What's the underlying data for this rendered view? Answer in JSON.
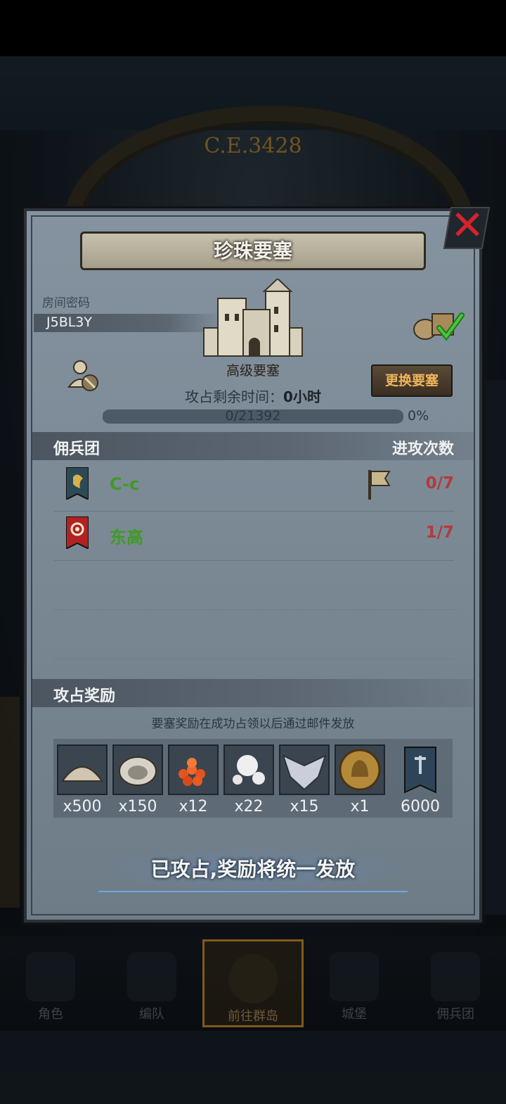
{
  "background": {
    "era_text": "C.E.3428"
  },
  "bottom_nav": [
    {
      "label": "角色"
    },
    {
      "label": "编队"
    },
    {
      "label": "前往群岛"
    },
    {
      "label": "城堡"
    },
    {
      "label": "佣兵团"
    }
  ],
  "dialog": {
    "title": "珍珠要塞",
    "room_label": "房间密码",
    "room_code": "J5BL3Y",
    "fortress_level": "高级要塞",
    "time_label": "攻占剩余时间：",
    "time_value": "0小时",
    "switch_button": "更换要塞",
    "progress_text": "0/21392",
    "progress_fraction": 0,
    "progress_percent": "0%",
    "mercenary_header": "佣兵团",
    "attack_header": "进攻次数",
    "mercenaries": [
      {
        "name": "C-c",
        "attacks": "0/7",
        "banner_color": "#2c4a55",
        "emblem_color": "#d7b24a"
      },
      {
        "name": "东高",
        "attacks": "1/7",
        "banner_color": "#b32222",
        "emblem_color": "#f2e8d0"
      }
    ],
    "reward_header": "攻占奖励",
    "reward_note": "要塞奖励在成功占领以后通过邮件发放",
    "rewards": [
      {
        "qty": "x500",
        "icon": "sand-pile-icon"
      },
      {
        "qty": "x150",
        "icon": "oyster-icon"
      },
      {
        "qty": "x12",
        "icon": "fish-roe-icon"
      },
      {
        "qty": "x22",
        "icon": "pearl-icon"
      },
      {
        "qty": "x15",
        "icon": "winged-emblem-icon"
      },
      {
        "qty": "x1",
        "icon": "knight-medal-icon"
      },
      {
        "qty": "6000",
        "icon": "guild-banner-icon"
      }
    ],
    "status_button": "已攻占,奖励将统一发放"
  }
}
